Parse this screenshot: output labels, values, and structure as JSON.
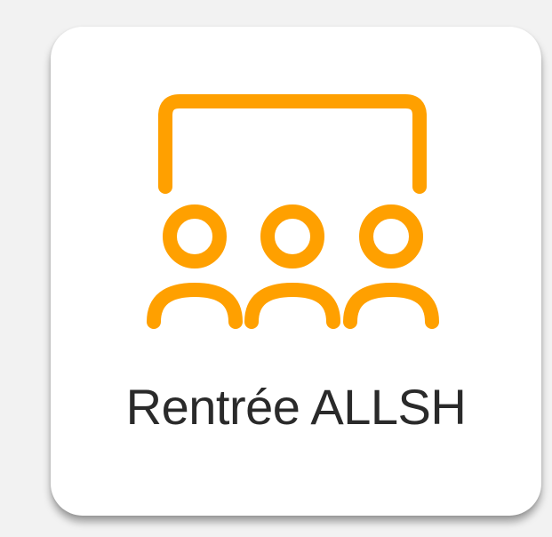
{
  "tile": {
    "icon": "classroom-audience-icon",
    "icon_color": "#FFA000",
    "label": "Rentrée ALLSH"
  }
}
